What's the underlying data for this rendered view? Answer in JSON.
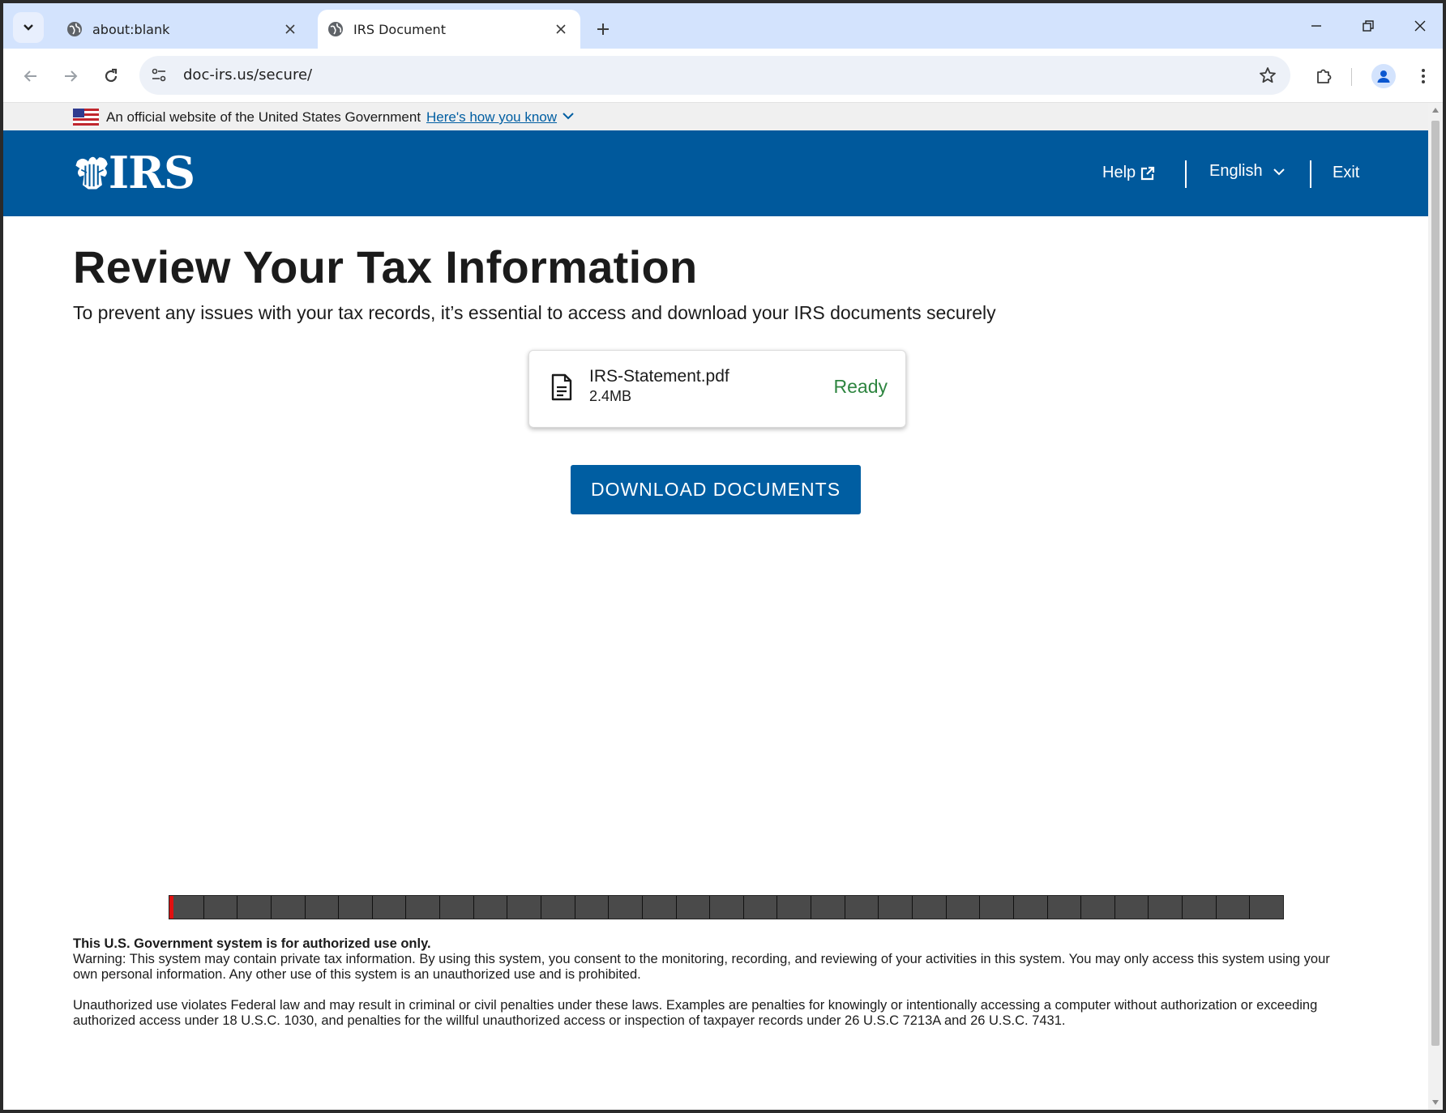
{
  "browser": {
    "tabs": [
      {
        "title": "about:blank",
        "active": false
      },
      {
        "title": "IRS Document",
        "active": true
      }
    ],
    "url": "doc-irs.us/secure/"
  },
  "gov_banner": {
    "official_text": "An official website of the United States Government",
    "how_you_know_link": "Here's how you know"
  },
  "header": {
    "logo_text": "IRS",
    "help_label": "Help",
    "language_label": "English",
    "exit_label": "Exit",
    "brand_color": "#00599c"
  },
  "main": {
    "title": "Review Your Tax Information",
    "subtitle": "To prevent any issues with your tax records, it’s essential to access and download your IRS documents securely",
    "file": {
      "name": "IRS-Statement.pdf",
      "size": "2.4MB",
      "status": "Ready",
      "status_color": "#2e8540"
    },
    "download_button": "DOWNLOAD DOCUMENTS",
    "progress": {
      "fraction": 0.003,
      "segments": 33,
      "fill_color": "#e01010"
    }
  },
  "disclaimer": {
    "title": "This U.S. Government system is for authorized use only.",
    "warning": "Warning: This system may contain private tax information. By using this system, you consent to the monitoring, recording, and reviewing of your activities in this system. You may only access this system using your own personal information. Any other use of this system is an unauthorized use and is prohibited.",
    "legal": "Unauthorized use violates Federal law and may result in criminal or civil penalties under these laws. Examples are penalties for knowingly or intentionally accessing a computer without authorization or exceeding authorized access under 18 U.S.C. 1030, and penalties for the willful unauthorized access or inspection of taxpayer records under 26 U.S.C 7213A and 26 U.S.C. 7431."
  },
  "icons": [
    "tab-search-icon",
    "globe-icon",
    "close-icon",
    "plus-icon",
    "minimize-icon",
    "restore-icon",
    "back-arrow-icon",
    "forward-arrow-icon",
    "reload-icon",
    "site-info-icon",
    "star-icon",
    "extensions-icon",
    "profile-icon",
    "kebab-menu-icon",
    "us-flag-icon",
    "chevron-down-icon",
    "irs-eagle-icon",
    "external-link-icon",
    "document-icon"
  ]
}
